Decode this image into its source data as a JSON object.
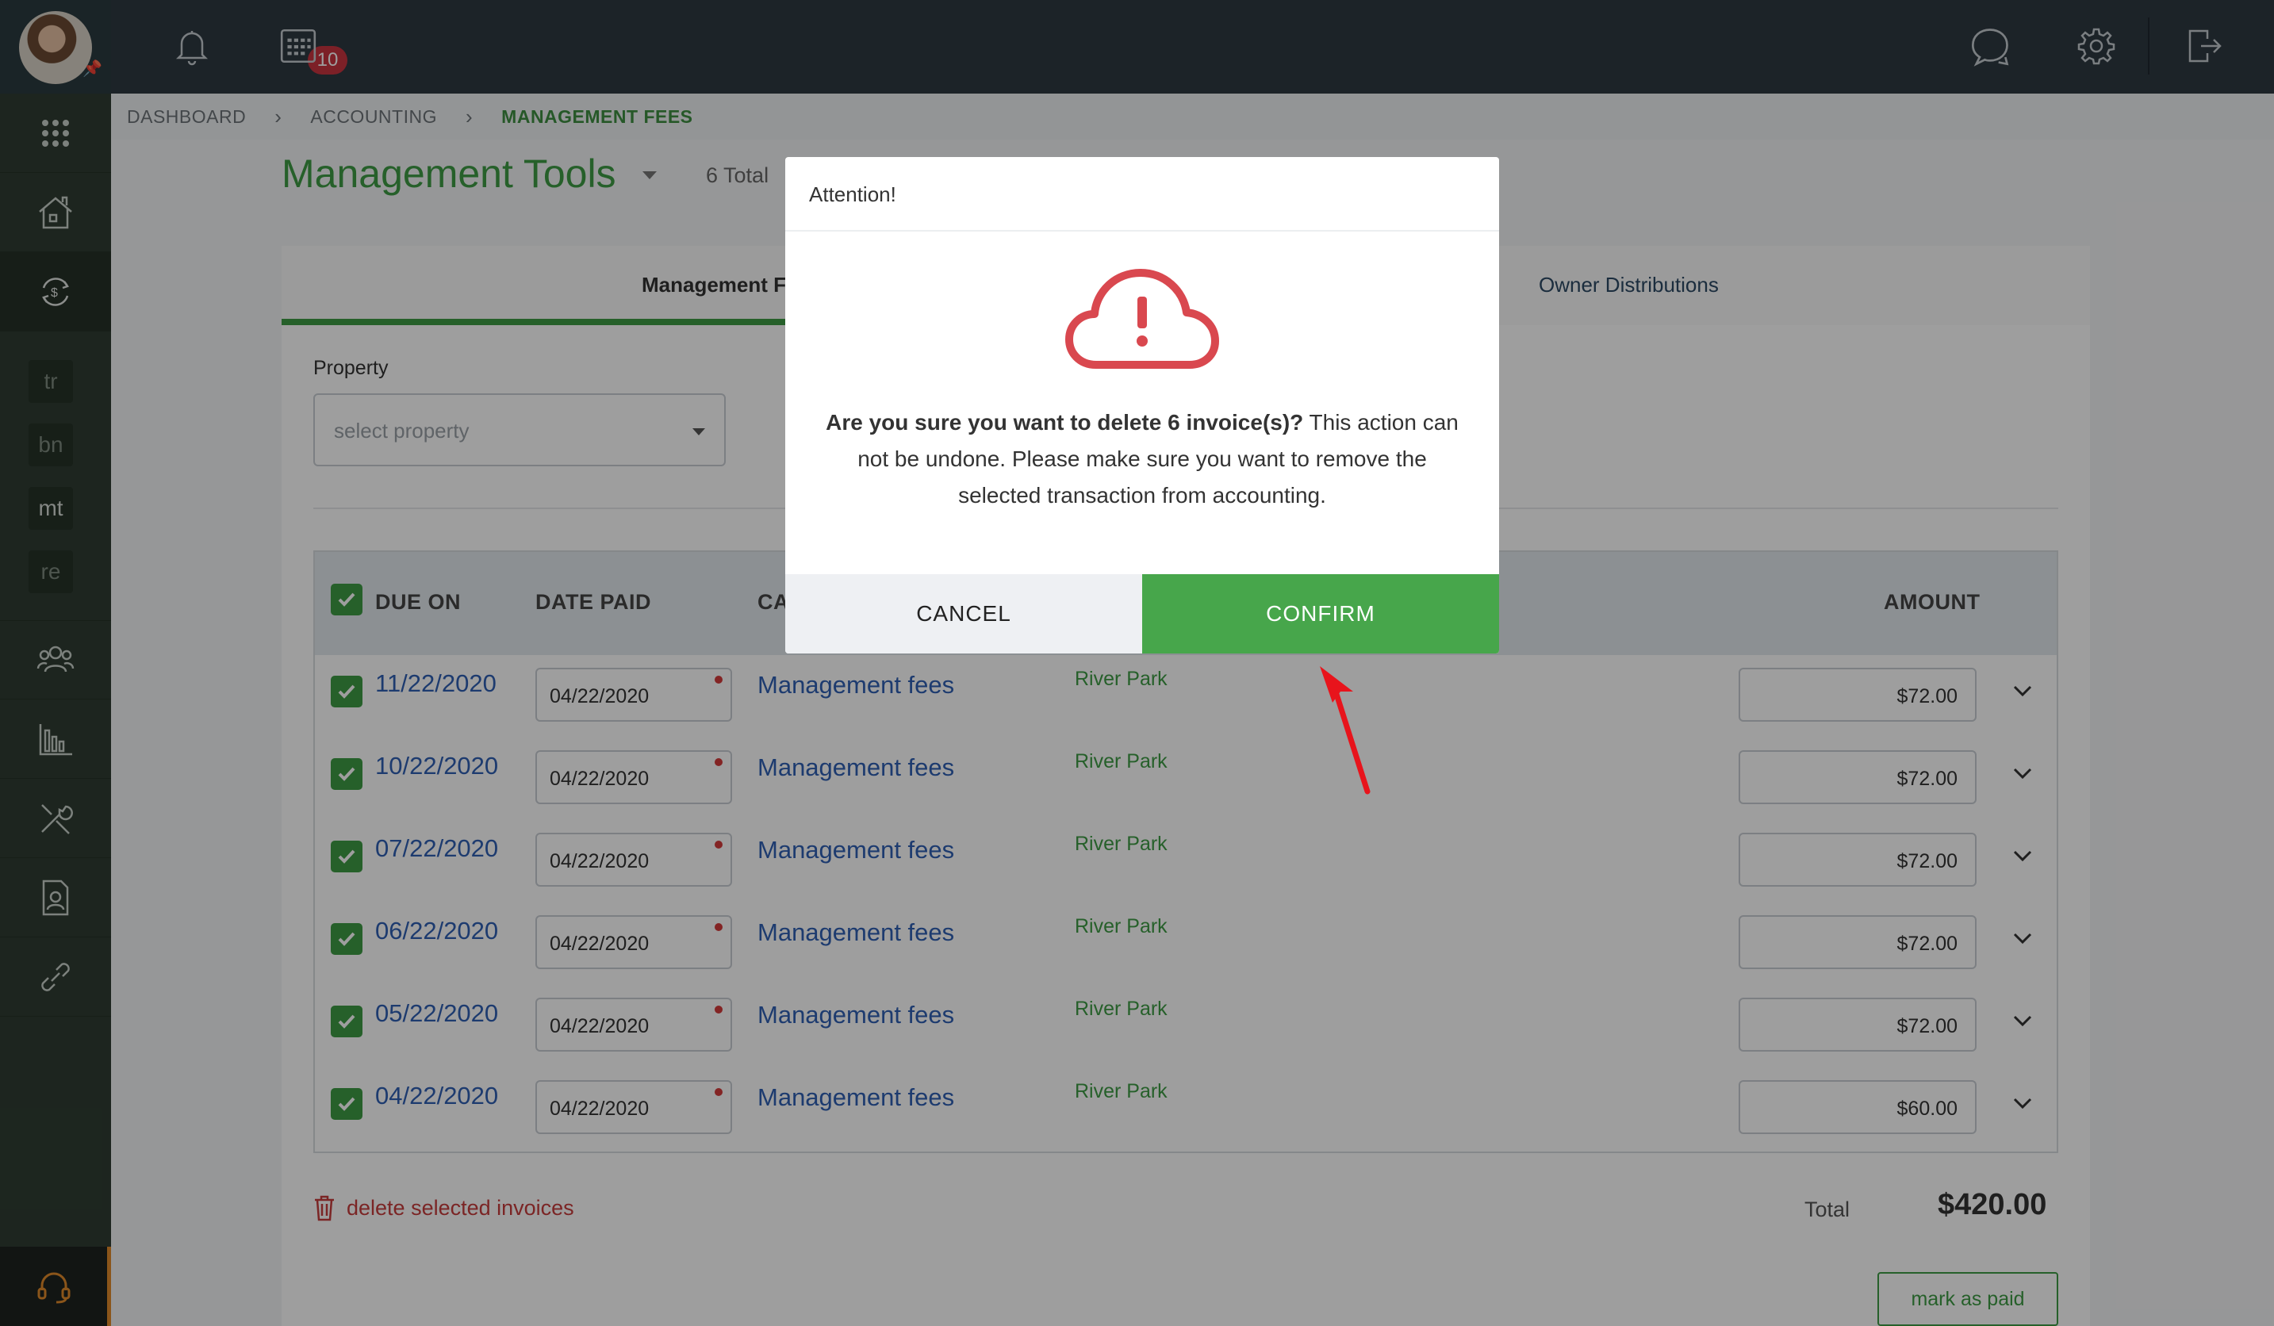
{
  "topbar": {
    "notification_count": "10"
  },
  "sidebar": {
    "chips": [
      "tr",
      "bn",
      "mt",
      "re"
    ]
  },
  "breadcrumb": [
    "DASHBOARD",
    "ACCOUNTING",
    "MANAGEMENT FEES"
  ],
  "header": {
    "title": "Management Tools",
    "total": "6 Total"
  },
  "tabs": {
    "active": "Management F",
    "other": "Owner Distributions"
  },
  "filter": {
    "label": "Property",
    "placeholder": "select property"
  },
  "table": {
    "headers": {
      "due_on": "DUE ON",
      "date_paid": "DATE PAID",
      "category": "CA",
      "amount": "AMOUNT"
    },
    "rows": [
      {
        "due": "11/22/2020",
        "paid": "04/22/2020",
        "category": "Management fees",
        "property": "River Park",
        "amount": "$72.00"
      },
      {
        "due": "10/22/2020",
        "paid": "04/22/2020",
        "category": "Management fees",
        "property": "River Park",
        "amount": "$72.00"
      },
      {
        "due": "07/22/2020",
        "paid": "04/22/2020",
        "category": "Management fees",
        "property": "River Park",
        "amount": "$72.00"
      },
      {
        "due": "06/22/2020",
        "paid": "04/22/2020",
        "category": "Management fees",
        "property": "River Park",
        "amount": "$72.00"
      },
      {
        "due": "05/22/2020",
        "paid": "04/22/2020",
        "category": "Management fees",
        "property": "River Park",
        "amount": "$72.00"
      },
      {
        "due": "04/22/2020",
        "paid": "04/22/2020",
        "category": "Management fees",
        "property": "River Park",
        "amount": "$60.00"
      }
    ]
  },
  "footer": {
    "delete_label": "delete selected invoices",
    "total_label": "Total",
    "total_value": "$420.00",
    "mark_paid": "mark as paid"
  },
  "modal": {
    "title": "Attention!",
    "message_bold": "Are you sure you want to delete 6 invoice(s)?",
    "message_rest": " This action can not be undone. Please make sure you want to remove the selected transaction from accounting.",
    "cancel": "CANCEL",
    "confirm": "CONFIRM"
  },
  "colors": {
    "brand_green": "#3e9b45",
    "confirm_green": "#47a64b",
    "alert_red": "#d9484f",
    "link_blue": "#2f5fb3",
    "sidebar": "#2f3d32",
    "topbar": "#2e3942"
  },
  "icons": [
    "bell-icon",
    "calendar-icon",
    "chat-icon",
    "gear-icon",
    "logout-icon",
    "apps-grid-icon",
    "house-icon",
    "dollar-cycle-icon",
    "people-icon",
    "chart-icon",
    "tools-icon",
    "document-user-icon",
    "link-icon",
    "headset-icon",
    "cloud-alert-icon",
    "trash-icon",
    "chevron-down-icon",
    "checkbox-icon",
    "arrow-annotation-icon"
  ]
}
